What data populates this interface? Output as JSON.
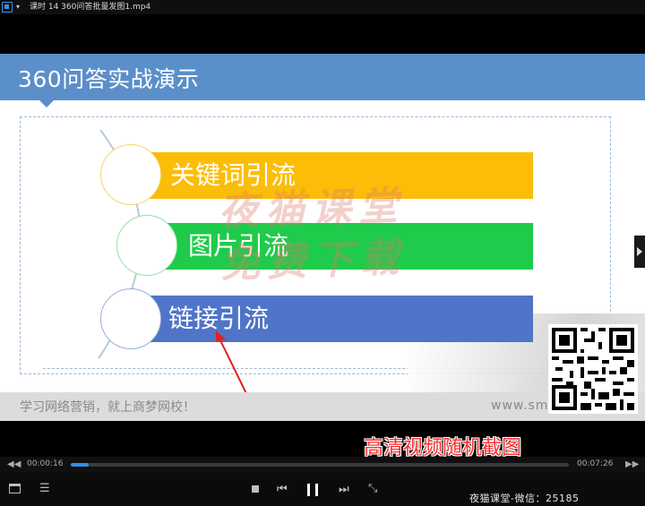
{
  "titlebar": {
    "title": "课时 14   360问答批量发图1.mp4"
  },
  "slide": {
    "title": "360问答实战演示",
    "items": [
      {
        "label": "关键词引流",
        "color": "#fbbd08"
      },
      {
        "label": "图片引流",
        "color": "#1fcb4a"
      },
      {
        "label": "链接引流",
        "color": "#4f74c8"
      }
    ],
    "watermark_lines": [
      "夜猫课堂",
      "免费下载"
    ],
    "footer_slogan": "学习网络营销，就上商梦网校！",
    "footer_url": "www.sm"
  },
  "caption": "高清视频随机截图",
  "player": {
    "current_time": "00:00:16",
    "total_time": "00:07:26",
    "progress_fraction": 0.036,
    "accent": "#2f8fe8",
    "bottom_watermark": "夜猫课堂-微信：25185"
  }
}
